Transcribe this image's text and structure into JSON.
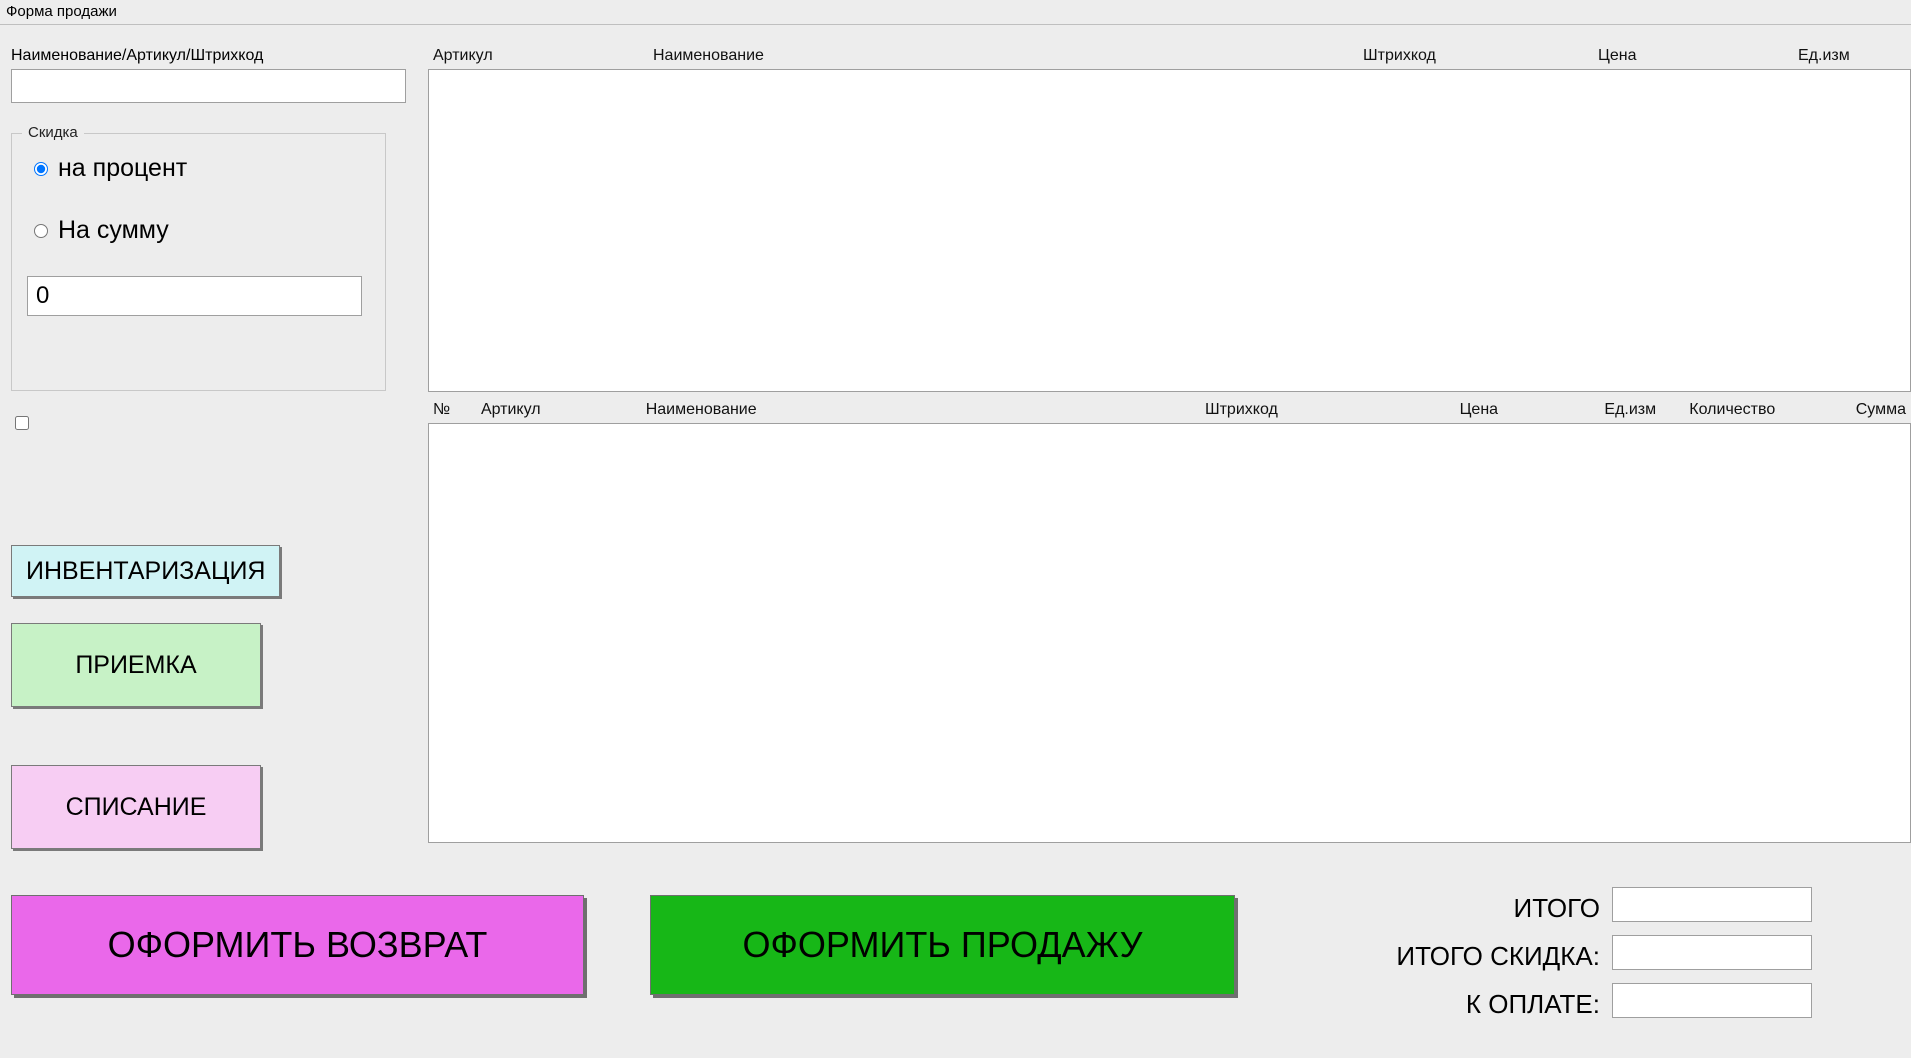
{
  "window_title": "Форма продажи",
  "search": {
    "label": "Наименование/Артикул/Штрихкод",
    "value": ""
  },
  "discount": {
    "legend": "Скидка",
    "option_percent": "на процент",
    "option_sum": "На сумму",
    "selected": "percent",
    "value": "0"
  },
  "checkbox_checked": false,
  "sidebar_buttons": {
    "inventory": "ИНВЕНТАРИЗАЦИЯ",
    "receipt": "ПРИЕМКА",
    "writeoff": "СПИСАНИЕ"
  },
  "bottom_buttons": {
    "return": "ОФОРМИТЬ ВОЗВРАТ",
    "sale": "ОФОРМИТЬ ПРОДАЖУ"
  },
  "search_table": {
    "columns": {
      "article": "Артикул",
      "name": "Наименование",
      "barcode": "Штрихкод",
      "price": "Цена",
      "unit": "Ед.изм"
    },
    "rows": []
  },
  "cart_table": {
    "columns": {
      "num": "№",
      "article": "Артикул",
      "name": "Наименование",
      "barcode": "Штрихкод",
      "price": "Цена",
      "unit": "Ед.изм",
      "qty": "Количество",
      "sum": "Сумма"
    },
    "rows": []
  },
  "totals": {
    "total_label": "ИТОГО",
    "discount_label": "ИТОГО СКИДКА:",
    "pay_label": "К ОПЛАТЕ:",
    "total_value": "",
    "discount_value": "",
    "pay_value": ""
  }
}
